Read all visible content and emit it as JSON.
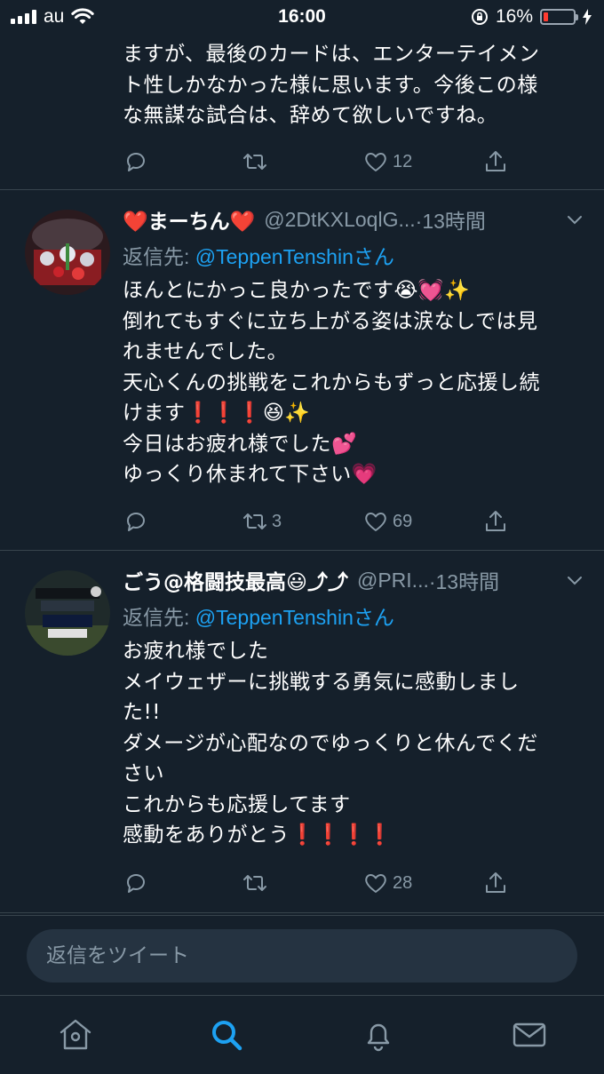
{
  "status_bar": {
    "carrier": "au",
    "time": "16:00",
    "battery_percent": "16%",
    "battery_level": 0.16
  },
  "tweets": [
    {
      "text": "ますが、最後のカードは、エンターテイメン\nト性しかなかった様に思います。今後この様\nな無謀な試合は、辞めて欲しいですね。",
      "retweets": "",
      "likes": "12"
    },
    {
      "display_name": "❤️まーちん❤️",
      "handle": "@2DtKXLoqlG...",
      "time": "·13時間",
      "reply_prefix": "返信先: ",
      "reply_mention": "@TeppenTenshinさん",
      "text": "ほんとにかっこ良かったです😭💓✨\n倒れてもすぐに立ち上がる姿は涙なしでは見\nれませんでした。\n天心くんの挑戦をこれからもずっと応援し続\nけます❗️❗️❗️😆✨\n今日はお疲れ様でした💕\nゆっくり休まれて下さい💗",
      "retweets": "3",
      "likes": "69"
    },
    {
      "display_name": "ごう@格闘技最高😃⤴︎⤴︎",
      "handle": "@PRI...",
      "time": "·13時間",
      "reply_prefix": "返信先: ",
      "reply_mention": "@TeppenTenshinさん",
      "text": "お疲れ様でした\nメイウェザーに挑戦する勇気に感動しまし\nた!!\nダメージが心配なのでゆっくりと休んでくだ\nさい\nこれからも応援してます\n感動をありがとう❗️❗️❗️❗️",
      "retweets": "",
      "likes": "28"
    }
  ],
  "reply_bar": {
    "placeholder": "返信をツイート"
  },
  "tab_bar": {
    "active": "search",
    "items": [
      "home",
      "search",
      "notifications",
      "messages"
    ]
  },
  "colors": {
    "background": "#15202b",
    "accent": "#1da1f2",
    "secondary_text": "#8899a6",
    "divider": "#38444d"
  }
}
